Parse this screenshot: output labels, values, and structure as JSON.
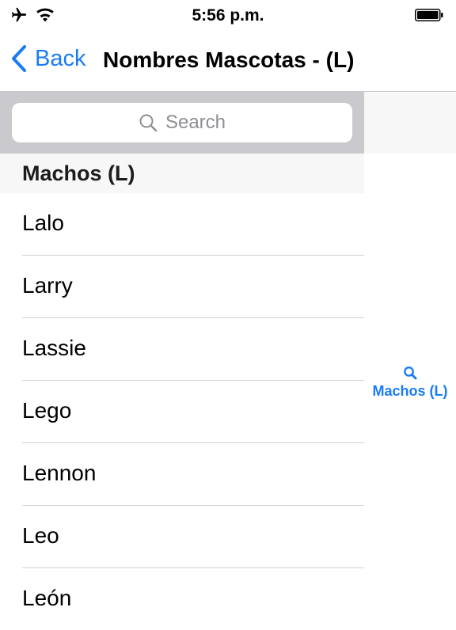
{
  "status_bar": {
    "time": "5:56 p.m.",
    "icons": [
      "airplane-icon",
      "wifi-icon",
      "battery-icon"
    ]
  },
  "nav": {
    "back_label": "Back",
    "title": "Nombres Mascotas - (L)"
  },
  "search": {
    "placeholder": "Search"
  },
  "section": {
    "header": "Machos (L)",
    "items": [
      "Lalo",
      "Larry",
      "Lassie",
      "Lego",
      "Lennon",
      "Leo",
      "León"
    ]
  },
  "index": {
    "icon": "search-icon",
    "label": "Machos (L)"
  },
  "colors": {
    "accent": "#1a7cf5",
    "search_bar_bg": "#c9c9ce",
    "section_header_bg": "#f7f7f7",
    "separator": "#d1d1d6"
  }
}
